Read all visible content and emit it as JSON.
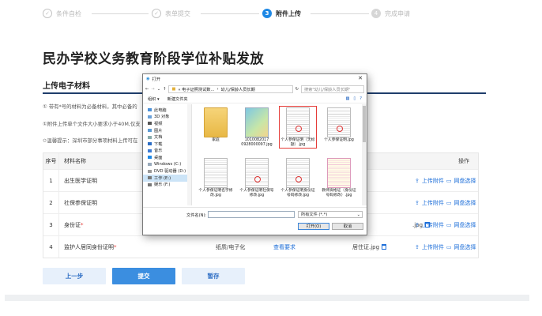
{
  "steps": [
    {
      "num": "✓",
      "label": "条件自检",
      "state": "done"
    },
    {
      "num": "✓",
      "label": "表单提交",
      "state": "done"
    },
    {
      "num": "3",
      "label": "附件上传",
      "state": "active"
    },
    {
      "num": "4",
      "label": "完成申请",
      "state": "future"
    }
  ],
  "page_title": "民办学校义务教育阶段学位补贴发放",
  "section_title": "上传电子材料",
  "notes": [
    "① 带有*号的材料为必备材料，其中必备的",
    "①附件上传单个文件大小要求小于40M,仅支",
    "✩温馨提示：深圳市部分事项材料上传可在"
  ],
  "table": {
    "head": {
      "num": "序号",
      "name": "材料名称",
      "ops": "操作"
    },
    "rows": [
      {
        "num": "1",
        "name": "出生医学证明",
        "required": false,
        "ops": [
          "上传附件",
          "网盘选择"
        ]
      },
      {
        "num": "2",
        "name": "社保参保证明",
        "required": false,
        "ops": [
          "上传附件",
          "网盘选择"
        ]
      },
      {
        "num": "3",
        "name": "身份证",
        "required": true,
        "file": ".jpg",
        "ops": [
          "上传附件",
          "网盘选择"
        ]
      },
      {
        "num": "4",
        "name": "监护人居同身份证明",
        "required": true,
        "type": "纸质/电子化",
        "look": "查看要求",
        "file": "居住证.jpg",
        "ops": [
          "上传附件",
          "网盘选择"
        ]
      }
    ]
  },
  "buttons": {
    "prev": "上一步",
    "submit": "提交",
    "save": "暂存"
  },
  "dialog": {
    "title": "打开",
    "path": [
      "«  电子证照测试数...",
      "幼儿/保龄人员长期"
    ],
    "search_placeholder": "搜索\"幼儿/保龄人员长期\"",
    "organize": "组织 ▾",
    "new_folder": "新建文件夹",
    "sidebar": [
      "此电脑",
      "3D 对象",
      "视频",
      "图片",
      "文档",
      "下载",
      "音乐",
      "桌面",
      "Windows (C:)",
      "DVD 驱动器 (D:)",
      "工作 (E:)",
      "娱乐 (F:)"
    ],
    "files": [
      {
        "name": "家庭",
        "kind": "folder"
      },
      {
        "name": "1010082017 0928000097.jpg",
        "kind": "photo"
      },
      {
        "name": "个人参保证明（无标题）.jpg",
        "kind": "doc",
        "highlight": true
      },
      {
        "name": "个人参保证明.jpg",
        "kind": "doc"
      },
      {
        "name": "个人参保证明名字修改.jpg",
        "kind": "doc"
      },
      {
        "name": "个人参保证明社保号修改.jpg",
        "kind": "doc"
      },
      {
        "name": "个人参保证明身份证号码修改.jpg",
        "kind": "doc"
      },
      {
        "name": "教师资格证（身份证号码修改）.jpg",
        "kind": "doc2"
      }
    ],
    "filename_label": "文件名(N):",
    "filetype": "所有文件 (*.*)",
    "open": "打开(O)",
    "cancel": "取消"
  }
}
